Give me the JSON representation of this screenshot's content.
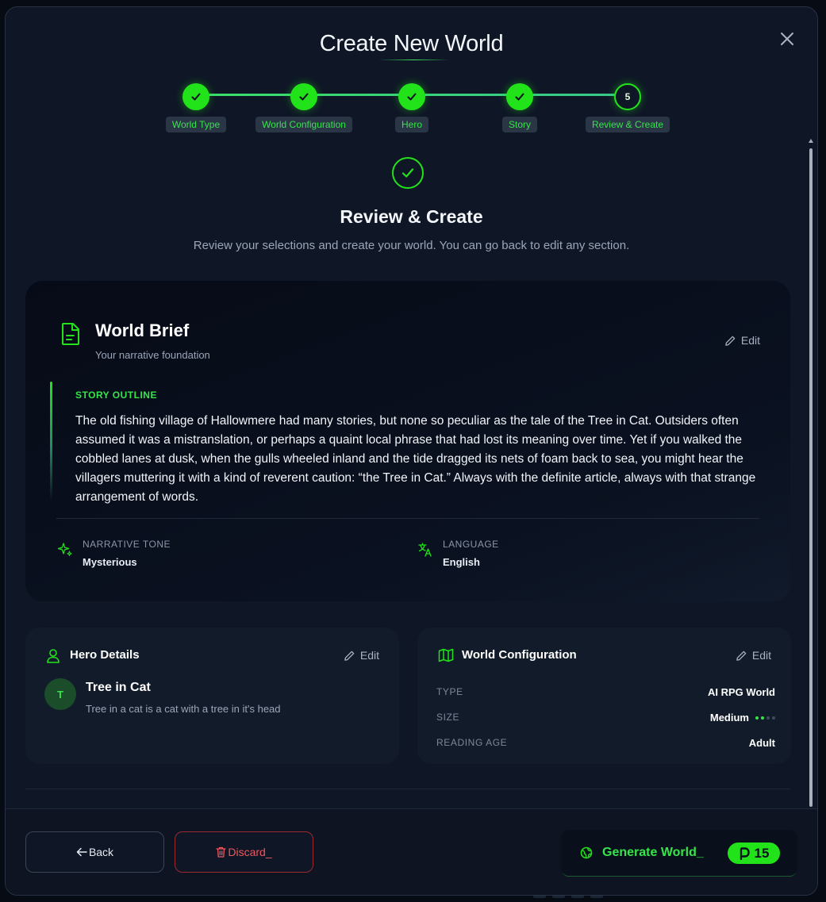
{
  "modal": {
    "title": "Create New World"
  },
  "steps": [
    {
      "label": "World Type",
      "state": "done"
    },
    {
      "label": "World Configuration",
      "state": "done"
    },
    {
      "label": "Hero",
      "state": "done"
    },
    {
      "label": "Story",
      "state": "done"
    },
    {
      "label": "Review & Create",
      "state": "current",
      "number": "5"
    }
  ],
  "review": {
    "title": "Review & Create",
    "subtitle": "Review your selections and create your world. You can go back to edit any section."
  },
  "brief": {
    "icon": "document-icon",
    "title": "World Brief",
    "subtitle": "Your narrative foundation",
    "edit_label": "Edit",
    "outline_label": "STORY OUTLINE",
    "outline_text": "The old fishing village of Hallowmere had many stories, but none so peculiar as the tale of the Tree in Cat. Outsiders often assumed it was a mistranslation, or perhaps a quaint local phrase that had lost its meaning over time. Yet if you walked the cobbled lanes at dusk, when the gulls wheeled inland and the tide dragged its nets of foam back to sea, you might hear the villagers muttering it with a kind of reverent caution: “the Tree in Cat.” Always with the definite article, always with that strange arrangement of words.",
    "tone_label": "NARRATIVE TONE",
    "tone_value": "Mysterious",
    "language_label": "LANGUAGE",
    "language_value": "English"
  },
  "hero_card": {
    "title": "Hero Details",
    "edit_label": "Edit",
    "avatar_initial": "T",
    "name": "Tree in Cat",
    "description": "Tree in a cat is a cat with a tree in it's head"
  },
  "config_card": {
    "title": "World Configuration",
    "edit_label": "Edit",
    "rows": [
      {
        "label": "TYPE",
        "value": "AI RPG World"
      },
      {
        "label": "SIZE",
        "value": "Medium",
        "level": 2,
        "max": 4
      },
      {
        "label": "READING AGE",
        "value": "Adult"
      }
    ]
  },
  "footer": {
    "back_label": "Back",
    "discard_label": "Discard_",
    "generate_label": "Generate World_",
    "credits": "15"
  },
  "colors": {
    "accent": "#22e31a",
    "danger": "#f0565e",
    "background": "#0f1726"
  }
}
